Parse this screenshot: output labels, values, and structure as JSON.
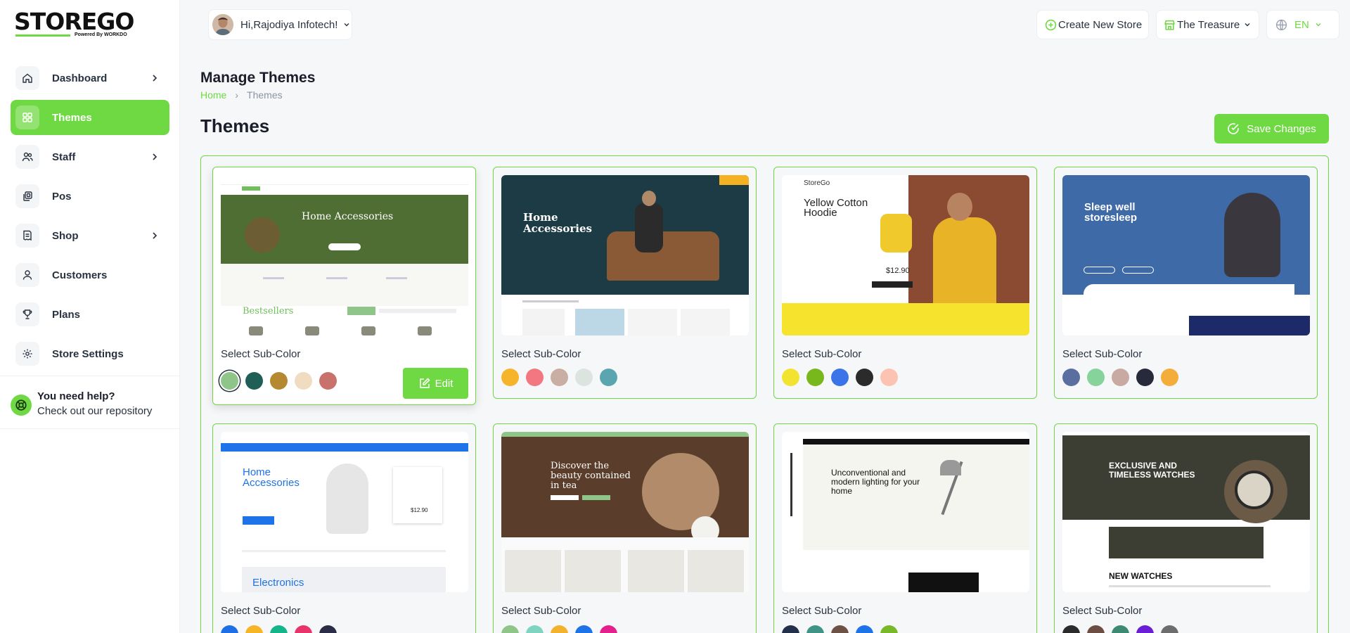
{
  "logo": {
    "text_store": "STORE",
    "text_go": "GO",
    "powered_by": "Powered By WORKDO"
  },
  "sidebar": {
    "items": [
      {
        "label": "Dashboard",
        "icon": "home-icon",
        "has_submenu": true,
        "active": false
      },
      {
        "label": "Themes",
        "icon": "grid-icon",
        "has_submenu": false,
        "active": true
      },
      {
        "label": "Staff",
        "icon": "users-icon",
        "has_submenu": true,
        "active": false
      },
      {
        "label": "Pos",
        "icon": "layers-icon",
        "has_submenu": false,
        "active": false
      },
      {
        "label": "Shop",
        "icon": "receipt-icon",
        "has_submenu": true,
        "active": false
      },
      {
        "label": "Customers",
        "icon": "user-icon",
        "has_submenu": false,
        "active": false
      },
      {
        "label": "Plans",
        "icon": "trophy-icon",
        "has_submenu": false,
        "active": false
      },
      {
        "label": "Store Settings",
        "icon": "settings-icon",
        "has_submenu": false,
        "active": false
      }
    ],
    "help": {
      "title": "You need help?",
      "subtitle": "Check out our repository"
    }
  },
  "header": {
    "user_greeting": "Hi,Rajodiya Infotech!",
    "create_store": "Create New Store",
    "store_name": "The Treasure",
    "language": "EN"
  },
  "page": {
    "title": "Manage Themes",
    "breadcrumb": [
      "Home",
      "Themes"
    ],
    "section_title": "Themes",
    "save_label": "Save Changes"
  },
  "colors": {
    "accent": "#6fd943",
    "text": "#293240"
  },
  "themes": [
    {
      "sub_label": "Select Sub-Color",
      "preview_title": "Home Accessories",
      "preview_sub": "Bestsellers",
      "selected": true,
      "edit_label": "Edit",
      "swatches": [
        "#8fc589",
        "#1f5f56",
        "#b5892f",
        "#f0dcc0",
        "#c9726b"
      ]
    },
    {
      "sub_label": "Select Sub-Color",
      "preview_title": "Home Accessories",
      "selected": false,
      "swatches": [
        "#f6b42a",
        "#f27780",
        "#c9aea3",
        "#dce4e0",
        "#5ba5b0"
      ]
    },
    {
      "sub_label": "Select Sub-Color",
      "preview_title": "Yellow Cotton Hoodie",
      "preview_price": "$12.90",
      "preview_brand": "StoreGo",
      "selected": false,
      "swatches": [
        "#f3e331",
        "#78b81c",
        "#3a74e8",
        "#2b2b2b",
        "#fcc3b2"
      ]
    },
    {
      "sub_label": "Select Sub-Color",
      "preview_title": "Sleep well storesleep",
      "selected": false,
      "swatches": [
        "#5a6f9f",
        "#86d39b",
        "#c9aaa3",
        "#262a3a",
        "#f4ad3b"
      ]
    },
    {
      "sub_label": "Select Sub-Color",
      "preview_title": "Home Accessories",
      "preview_sub": "Electronics",
      "preview_price": "$12.90",
      "selected": false,
      "swatches": [
        "#1e6ee6",
        "#f5b525",
        "#15b58a",
        "#e8336b",
        "#2a2d45"
      ]
    },
    {
      "sub_label": "Select Sub-Color",
      "preview_title": "Discover the beauty contained in tea",
      "selected": false,
      "swatches": [
        "#8fc589",
        "#7fd4c1",
        "#f3b22e",
        "#1e73e8",
        "#e3208c"
      ]
    },
    {
      "sub_label": "Select Sub-Color",
      "preview_title": "Unconventional and modern lighting for your home",
      "selected": false,
      "swatches": [
        "#22304a",
        "#3f9486",
        "#6c5245",
        "#1e73e8",
        "#79b929"
      ]
    },
    {
      "sub_label": "Select Sub-Color",
      "preview_title": "EXCLUSIVE AND TIMELESS WATCHES",
      "preview_sub": "NEW WATCHES",
      "selected": false,
      "swatches": [
        "#2b2b2b",
        "#6c4e43",
        "#3c8a72",
        "#6a1fd6",
        "#6d6d6d"
      ]
    }
  ]
}
